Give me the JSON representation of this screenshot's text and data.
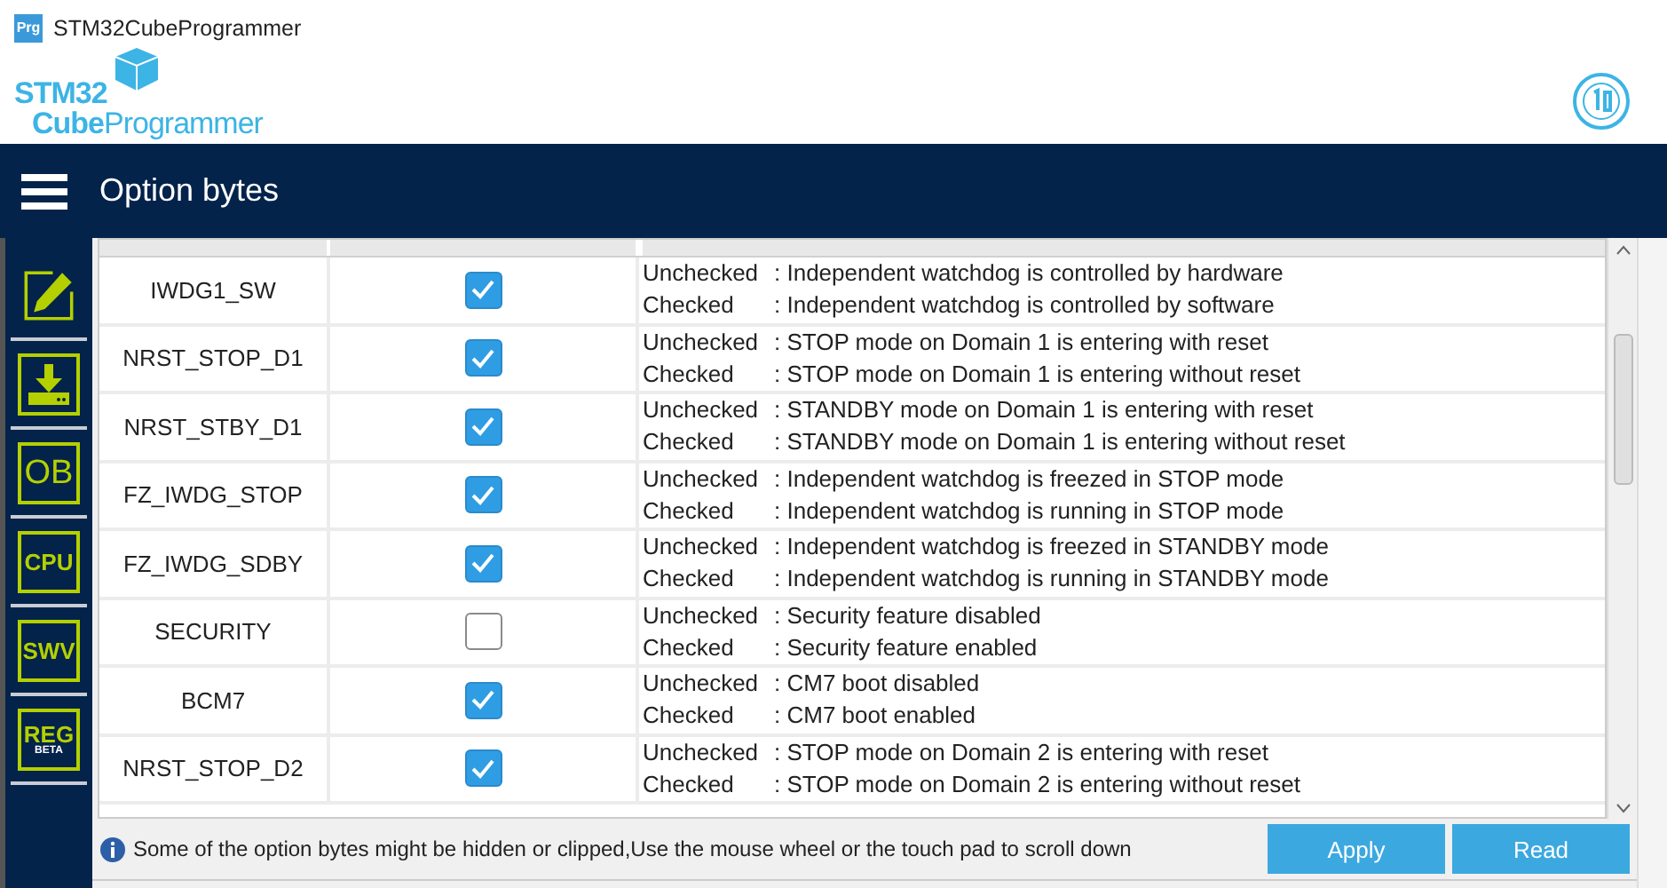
{
  "window": {
    "title": "STM32CubeProgrammer",
    "app_icon": "Prg"
  },
  "logo": {
    "line1": "STM32",
    "line2_bold": "Cube",
    "line2": "Programmer"
  },
  "header": {
    "title": "Option bytes"
  },
  "sidebar": {
    "items": [
      {
        "kind": "pencil"
      },
      {
        "kind": "download"
      },
      {
        "kind": "text",
        "label": "OB"
      },
      {
        "kind": "text",
        "label": "CPU"
      },
      {
        "kind": "text",
        "label": "SWV"
      },
      {
        "kind": "text",
        "label": "REG",
        "sub": "BETA"
      }
    ]
  },
  "table": {
    "rows": [
      {
        "name": "IWDG1_SW",
        "checked": true,
        "lines": [
          {
            "label": "Unchecked",
            "text": ": Independent watchdog is controlled by hardware"
          },
          {
            "label": "Checked",
            "text": ": Independent watchdog is controlled by software"
          }
        ]
      },
      {
        "name": "NRST_STOP_D1",
        "checked": true,
        "lines": [
          {
            "label": "Unchecked",
            "text": ": STOP mode on Domain 1 is entering with reset"
          },
          {
            "label": "Checked",
            "text": ": STOP mode on Domain 1 is entering without reset"
          }
        ]
      },
      {
        "name": "NRST_STBY_D1",
        "checked": true,
        "lines": [
          {
            "label": "Unchecked",
            "text": ": STANDBY mode on Domain 1 is entering with reset"
          },
          {
            "label": "Checked",
            "text": ": STANDBY mode on Domain 1 is entering without reset"
          }
        ]
      },
      {
        "name": "FZ_IWDG_STOP",
        "checked": true,
        "lines": [
          {
            "label": "Unchecked",
            "text": ": Independent watchdog is freezed in STOP mode"
          },
          {
            "label": "Checked",
            "text": ": Independent watchdog is running in STOP mode"
          }
        ]
      },
      {
        "name": "FZ_IWDG_SDBY",
        "checked": true,
        "lines": [
          {
            "label": "Unchecked",
            "text": ": Independent watchdog is freezed in STANDBY mode"
          },
          {
            "label": "Checked",
            "text": ": Independent watchdog is running in STANDBY mode"
          }
        ]
      },
      {
        "name": "SECURITY",
        "checked": false,
        "lines": [
          {
            "label": "Unchecked",
            "text": ": Security feature disabled"
          },
          {
            "label": "Checked",
            "text": ": Security feature enabled"
          }
        ]
      },
      {
        "name": "BCM7",
        "checked": true,
        "lines": [
          {
            "label": "Unchecked",
            "text": ": CM7 boot disabled"
          },
          {
            "label": "Checked",
            "text": ": CM7 boot enabled"
          }
        ]
      },
      {
        "name": "NRST_STOP_D2",
        "checked": true,
        "lines": [
          {
            "label": "Unchecked",
            "text": ": STOP mode on Domain 2 is entering with reset"
          },
          {
            "label": "Checked",
            "text": ": STOP mode on Domain 2 is entering without reset"
          }
        ]
      }
    ]
  },
  "info": "Some of the option bytes might be hidden or clipped,Use the mouse wheel or the touch pad to scroll down",
  "buttons": [
    "Apply",
    "Read"
  ]
}
